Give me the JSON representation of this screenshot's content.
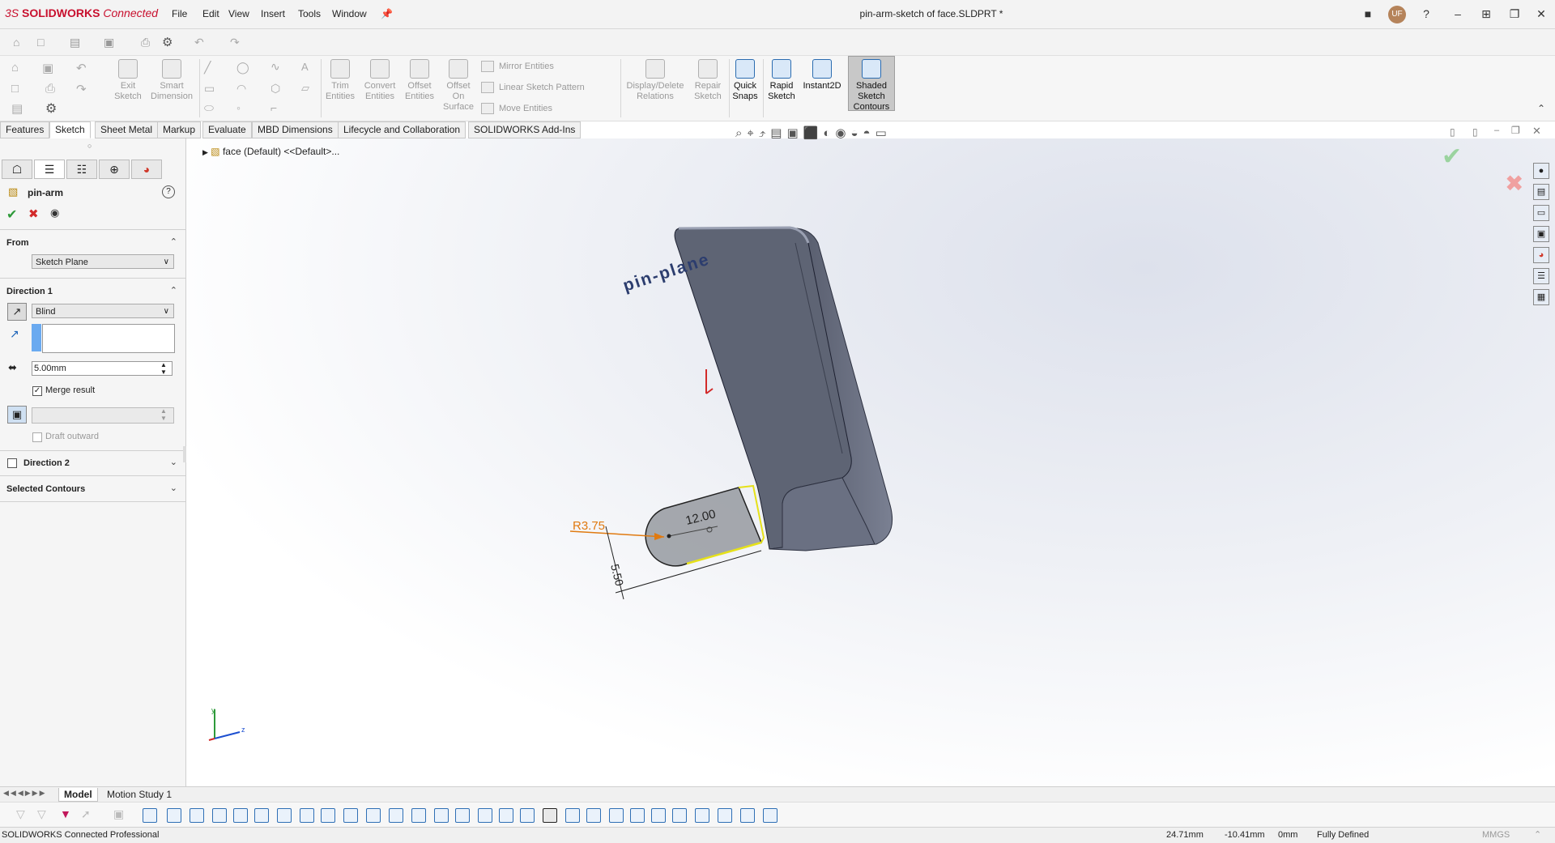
{
  "app": {
    "brand_bold": "SOLIDWORKS",
    "brand_rest": "Connected",
    "document_title": "pin-arm-sketch of face.SLDPRT *",
    "user_initials": "UF"
  },
  "menu": [
    "File",
    "Edit",
    "View",
    "Insert",
    "Tools",
    "Window"
  ],
  "ribbon": {
    "exit_sketch": "Exit Sketch",
    "smart_dimension": "Smart Dimension",
    "trim_entities": "Trim Entities",
    "convert_entities": "Convert Entities",
    "offset_entities": "Offset Entities",
    "offset_on_surface": "Offset On Surface",
    "mirror_entities": "Mirror Entities",
    "linear_sketch_pattern": "Linear Sketch Pattern",
    "move_entities": "Move Entities",
    "display_delete_relations": "Display/Delete Relations",
    "repair_sketch": "Repair Sketch",
    "quick_snaps": "Quick Snaps",
    "rapid_sketch": "Rapid Sketch",
    "instant2d": "Instant2D",
    "shaded_sketch_contours": "Shaded Sketch Contours"
  },
  "tabs": [
    "Features",
    "Sketch",
    "Sheet Metal",
    "Markup",
    "Evaluate",
    "MBD Dimensions",
    "Lifecycle and Collaboration",
    "SOLIDWORKS Add-Ins"
  ],
  "selected_tab": "Sketch",
  "property_manager": {
    "title": "pin-arm",
    "from_label": "From",
    "from_value": "Sketch Plane",
    "direction1_label": "Direction 1",
    "end_condition": "Blind",
    "depth": "5.00mm",
    "merge_result": "Merge result",
    "merge_checked": true,
    "draft_outward": "Draft outward",
    "direction2_label": "Direction 2",
    "selected_contours_label": "Selected Contours"
  },
  "feature_tree": {
    "root": "face (Default) <<Default>..."
  },
  "viewport": {
    "plane_label": "pin-plane",
    "dim_radius": "R3.75",
    "dim_length": "12.00",
    "dim_width": "5.50"
  },
  "bottom_tabs": [
    "Model",
    "Motion Study 1"
  ],
  "status": {
    "product": "SOLIDWORKS Connected Professional",
    "x": "24.71mm",
    "y": "-10.41mm",
    "z": "0mm",
    "state": "Fully Defined",
    "units": "MMGS"
  },
  "colors": {
    "accept": "#2e9a3a",
    "cancel": "#d22a2a",
    "dimension": "#e07a10",
    "part_fill": "#5e6474",
    "selection": "#e6e11a",
    "plane_label": "#2c3d6e"
  }
}
